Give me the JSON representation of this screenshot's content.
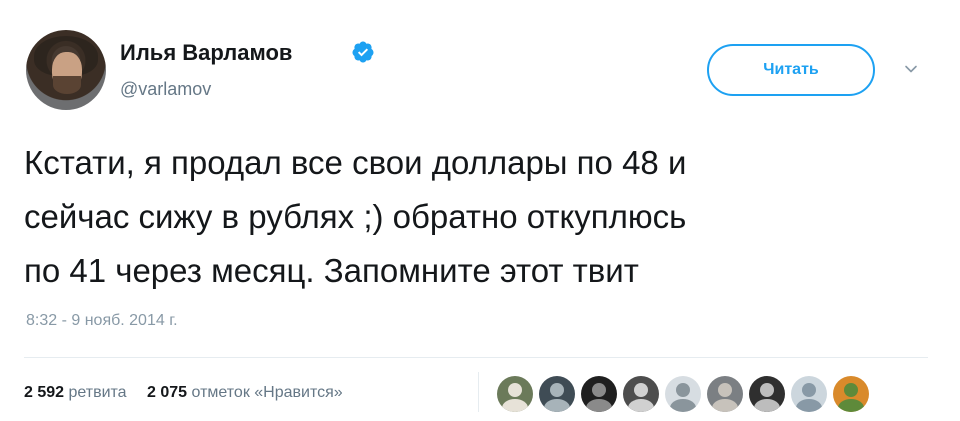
{
  "tweet": {
    "author_name": "Илья Варламов",
    "author_handle": "@varlamov",
    "follow_label": "Читать",
    "text_lines": [
      "Кстати, я продал все свои доллары по 48 и",
      "сейчас сижу в рублях ;) обратно откуплюсь",
      "по 41 через месяц. Запомните этот твит"
    ],
    "timestamp": "8:32 - 9 нояб. 2014 г.",
    "retweets_count": "2 592",
    "retweets_label": "ретвита",
    "likes_count": "2 075",
    "likes_label": "отметок «Нравится»"
  },
  "icons": {
    "verified": "verified-badge-icon",
    "caret": "chevron-down-icon"
  },
  "colors": {
    "accent": "#1da1f2",
    "text": "#14171a",
    "secondary": "#657786",
    "muted": "#8899a6"
  },
  "likers": [
    {
      "name": "liker-avatar",
      "bg": "#6b7a5a",
      "fg": "#e7e2d8"
    },
    {
      "name": "liker-avatar",
      "bg": "#3f4c55",
      "fg": "#a7b3b9"
    },
    {
      "name": "liker-avatar",
      "bg": "#1f1f1f",
      "fg": "#8a8a8a"
    },
    {
      "name": "liker-avatar",
      "bg": "#4d4d4d",
      "fg": "#d0d0d0"
    },
    {
      "name": "liker-avatar",
      "bg": "#d7dde2",
      "fg": "#8a959c"
    },
    {
      "name": "liker-avatar",
      "bg": "#7b7f83",
      "fg": "#c7c2bb"
    },
    {
      "name": "liker-avatar",
      "bg": "#2f2f2f",
      "fg": "#bdbdbd"
    },
    {
      "name": "liker-avatar",
      "bg": "#ccd6dd",
      "fg": "#8899a6"
    },
    {
      "name": "liker-avatar",
      "bg": "#d98a2b",
      "fg": "#5e8a3a"
    }
  ]
}
